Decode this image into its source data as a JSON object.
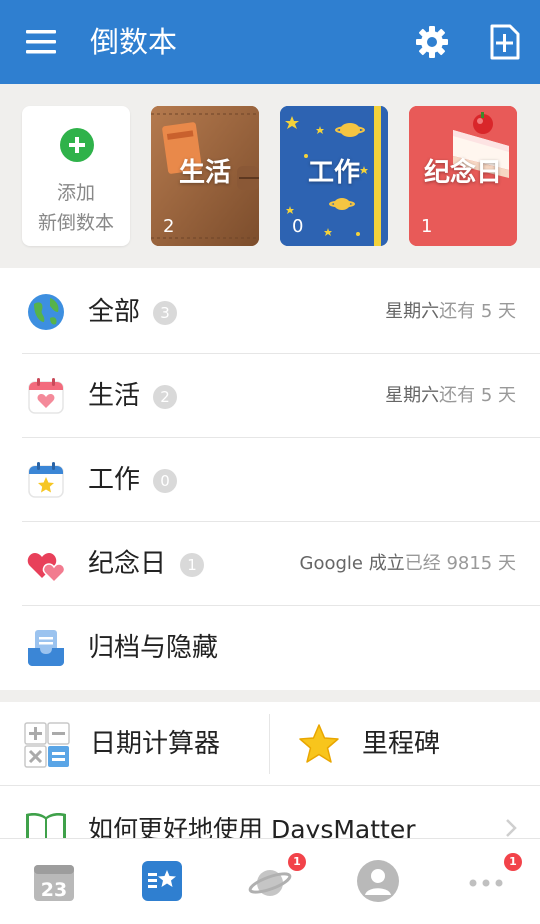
{
  "app": {
    "title": "倒数本"
  },
  "shelf": {
    "add_label_line1": "添加",
    "add_label_line2": "新倒数本",
    "books": [
      {
        "name": "生活",
        "count": "2"
      },
      {
        "name": "工作",
        "count": "0"
      },
      {
        "name": "纪念日",
        "count": "1"
      }
    ]
  },
  "categories": [
    {
      "label": "全部",
      "count": "3",
      "note_strong": "星期六",
      "note_rest": "还有 5 天"
    },
    {
      "label": "生活",
      "count": "2",
      "note_strong": "星期六",
      "note_rest": "还有 5 天"
    },
    {
      "label": "工作",
      "count": "0"
    },
    {
      "label": "纪念日",
      "count": "1",
      "note_strong": "Google 成立",
      "note_rest": "已经 9815 天"
    },
    {
      "label": "归档与隐藏"
    }
  ],
  "tools": {
    "calculator_label": "日期计算器",
    "milestone_label": "里程碑"
  },
  "howto": {
    "label": "如何更好地使用 DaysMatter"
  },
  "bottomnav": {
    "calendar_day": "23",
    "discover_badge": "1",
    "more_badge": "1"
  },
  "colors": {
    "primary": "#2f7fd0",
    "badge_red": "#f2434a",
    "add_green": "#2fb24a"
  }
}
